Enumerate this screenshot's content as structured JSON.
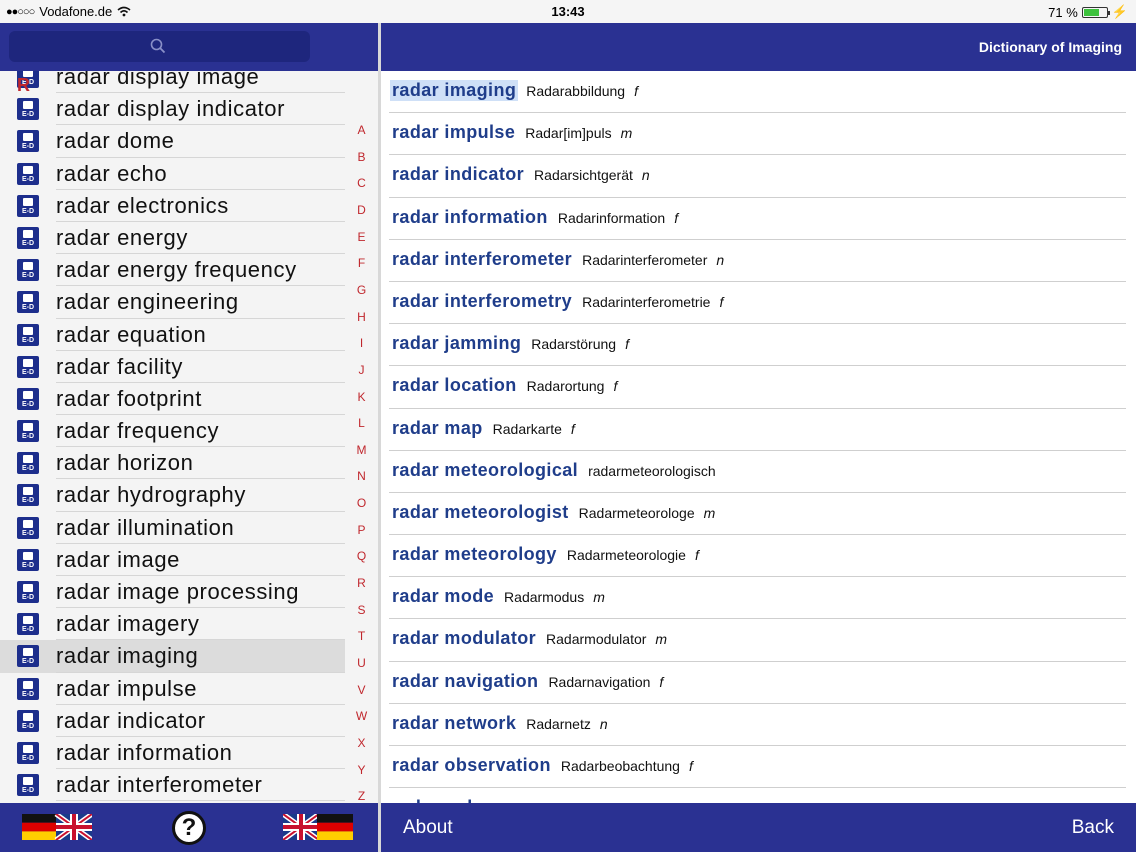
{
  "status_bar": {
    "carrier": "Vodafone.de",
    "signal": "●●○○○",
    "time": "13:43",
    "battery_text": "71 %",
    "battery_level": 0.71
  },
  "search": {
    "icon": "search-icon"
  },
  "sidebar": {
    "section_letter": "R",
    "items": [
      {
        "label": "radar display image"
      },
      {
        "label": "radar display indicator"
      },
      {
        "label": "radar dome"
      },
      {
        "label": "radar echo"
      },
      {
        "label": "radar electronics"
      },
      {
        "label": "radar energy"
      },
      {
        "label": "radar energy frequency"
      },
      {
        "label": "radar engineering"
      },
      {
        "label": "radar equation"
      },
      {
        "label": "radar facility"
      },
      {
        "label": "radar footprint"
      },
      {
        "label": "radar frequency"
      },
      {
        "label": "radar horizon"
      },
      {
        "label": "radar hydrography"
      },
      {
        "label": "radar illumination"
      },
      {
        "label": "radar image"
      },
      {
        "label": "radar image processing"
      },
      {
        "label": "radar imagery"
      },
      {
        "label": "radar imaging",
        "selected": true
      },
      {
        "label": "radar impulse"
      },
      {
        "label": "radar indicator"
      },
      {
        "label": "radar information"
      },
      {
        "label": "radar interferometer"
      }
    ],
    "item_icon_text": "E-D",
    "index_letters": [
      "A",
      "B",
      "C",
      "D",
      "E",
      "F",
      "G",
      "H",
      "I",
      "J",
      "K",
      "L",
      "M",
      "N",
      "O",
      "P",
      "Q",
      "R",
      "S",
      "T",
      "U",
      "V",
      "W",
      "X",
      "Y",
      "Z"
    ]
  },
  "left_footer": {
    "help_label": "?"
  },
  "header": {
    "title": "Dictionary of Imaging"
  },
  "entries": [
    {
      "term": "radar imaging",
      "translation": "Radarabbildung",
      "gender": "f",
      "highlight": true
    },
    {
      "term": "radar impulse",
      "translation": "Radar[im]puls",
      "gender": "m"
    },
    {
      "term": "radar indicator",
      "translation": "Radarsichtgerät",
      "gender": "n"
    },
    {
      "term": "radar information",
      "translation": "Radarinformation",
      "gender": "f"
    },
    {
      "term": "radar interferometer",
      "translation": "Radarinterferometer",
      "gender": "n"
    },
    {
      "term": "radar interferometry",
      "translation": "Radarinterferometrie",
      "gender": "f"
    },
    {
      "term": "radar jamming",
      "translation": "Radarstörung",
      "gender": "f"
    },
    {
      "term": "radar location",
      "translation": "Radarortung",
      "gender": "f"
    },
    {
      "term": "radar map",
      "translation": "Radarkarte",
      "gender": "f"
    },
    {
      "term": "radar meteorological",
      "translation": "radarmeteorologisch",
      "gender": ""
    },
    {
      "term": "radar meteorologist",
      "translation": "Radarmeteorologe",
      "gender": "m"
    },
    {
      "term": "radar meteorology",
      "translation": "Radarmeteorologie",
      "gender": "f"
    },
    {
      "term": "radar mode",
      "translation": "Radarmodus",
      "gender": "m"
    },
    {
      "term": "radar modulator",
      "translation": "Radarmodulator",
      "gender": "m"
    },
    {
      "term": "radar navigation",
      "translation": "Radarnavigation",
      "gender": "f"
    },
    {
      "term": "radar network",
      "translation": "Radarnetz",
      "gender": "n"
    },
    {
      "term": "radar observation",
      "translation": "Radarbeobachtung",
      "gender": "f"
    },
    {
      "term": "radar pulse",
      "translation": "",
      "gender": ""
    }
  ],
  "footer": {
    "about_label": "About",
    "back_label": "Back"
  },
  "colors": {
    "bar": "#2a3192",
    "term": "#1f3d8a",
    "index": "#c0272d"
  }
}
